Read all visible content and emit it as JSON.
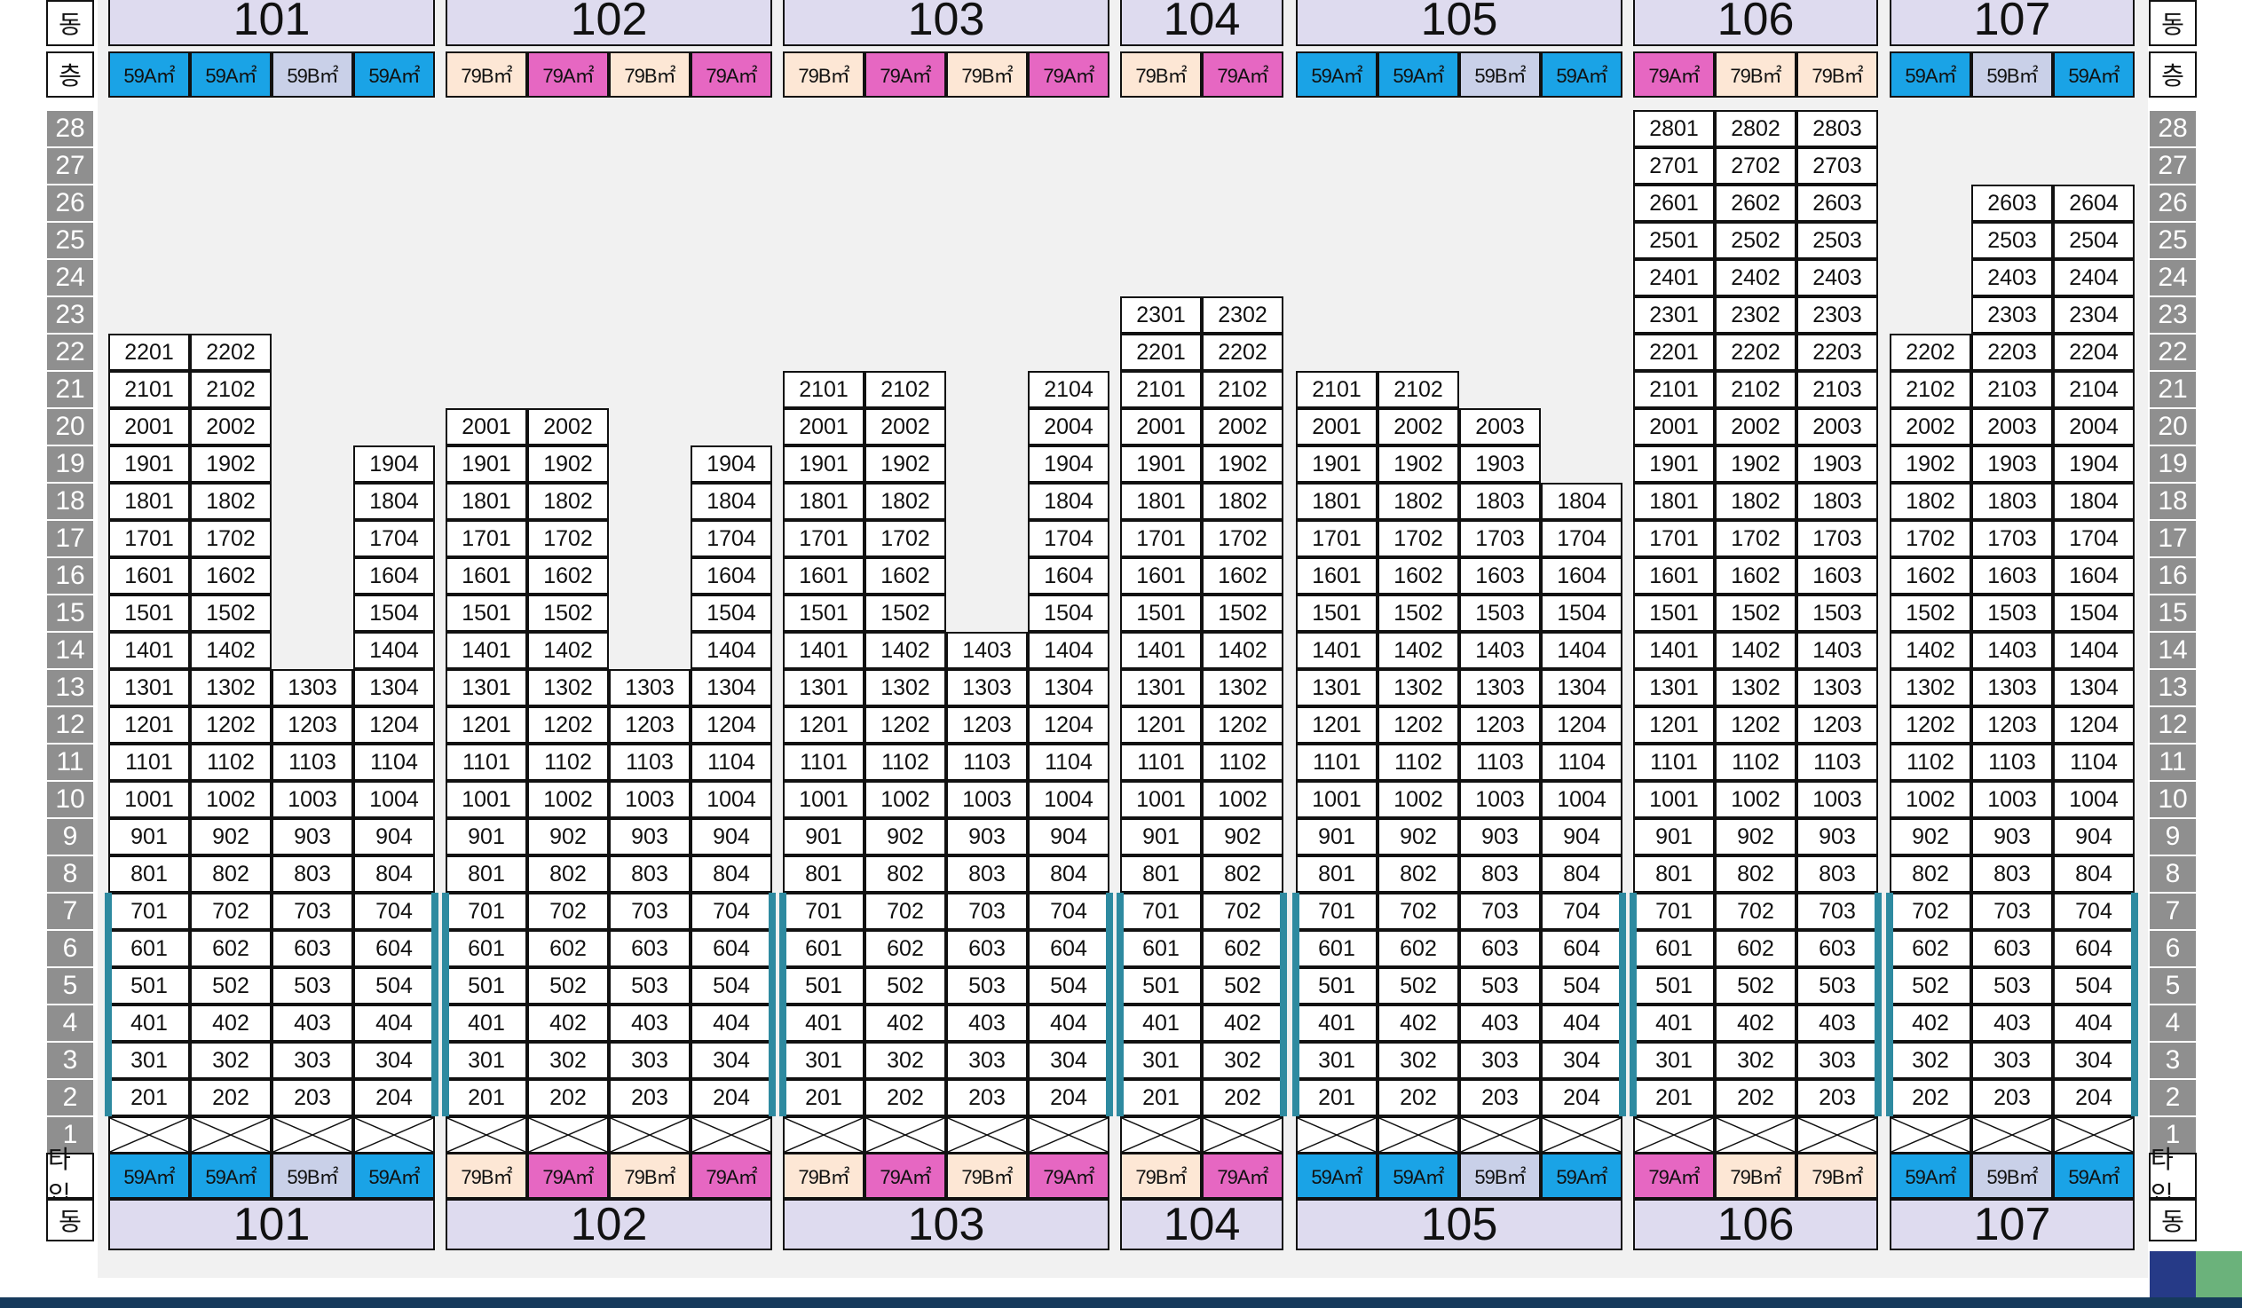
{
  "labels": {
    "dong": "동",
    "floor": "층",
    "type": "타입"
  },
  "type_colors": {
    "59A㎡": "#1aa3e6",
    "59B㎡": "#c9d0e8",
    "79A㎡": "#e667c2",
    "79B㎡": "#fde7d5"
  },
  "floors": [
    "28",
    "27",
    "26",
    "25",
    "24",
    "23",
    "22",
    "21",
    "20",
    "19",
    "18",
    "17",
    "16",
    "15",
    "14",
    "13",
    "12",
    "11",
    "10",
    "9",
    "8",
    "7",
    "6",
    "5",
    "4",
    "3",
    "2",
    "1"
  ],
  "buildings": [
    {
      "name": "101",
      "types": [
        "59A㎡",
        "59A㎡",
        "59B㎡",
        "59A㎡"
      ],
      "top_floors": [
        22,
        22,
        13,
        19
      ]
    },
    {
      "name": "102",
      "types": [
        "79B㎡",
        "79A㎡",
        "79B㎡",
        "79A㎡"
      ],
      "top_floors": [
        20,
        20,
        13,
        19
      ]
    },
    {
      "name": "103",
      "types": [
        "79B㎡",
        "79A㎡",
        "79B㎡",
        "79A㎡"
      ],
      "top_floors": [
        21,
        21,
        14,
        21
      ]
    },
    {
      "name": "104",
      "types": [
        "79B㎡",
        "79A㎡"
      ],
      "top_floors": [
        23,
        23
      ]
    },
    {
      "name": "105",
      "types": [
        "59A㎡",
        "59A㎡",
        "59B㎡",
        "59A㎡"
      ],
      "top_floors": [
        21,
        21,
        20,
        18
      ]
    },
    {
      "name": "106",
      "types": [
        "79A㎡",
        "79B㎡",
        "79B㎡"
      ],
      "top_floors": [
        28,
        28,
        28
      ]
    },
    {
      "name": "107",
      "types": [
        "59A㎡",
        "59B㎡",
        "59A㎡"
      ],
      "top_floors": [
        22,
        26,
        26
      ],
      "line_offset": 1
    }
  ]
}
